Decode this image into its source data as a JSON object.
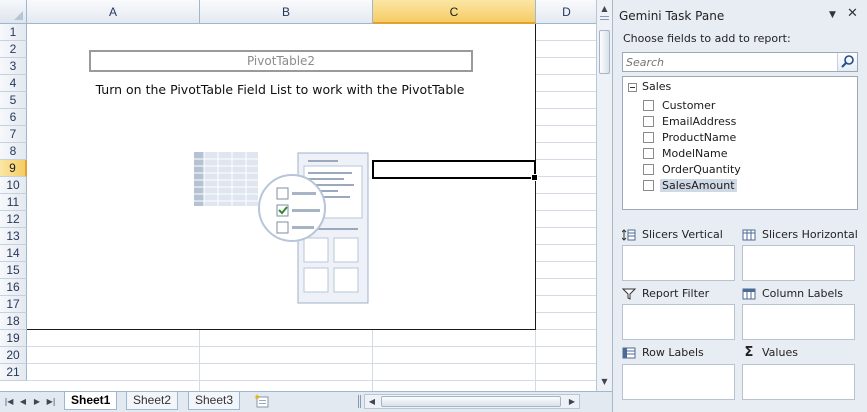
{
  "sheet": {
    "columns": [
      "A",
      "B",
      "C",
      "D"
    ],
    "selected_column": "C",
    "rows": [
      "1",
      "2",
      "3",
      "4",
      "5",
      "6",
      "7",
      "8",
      "9",
      "10",
      "11",
      "12",
      "13",
      "14",
      "15",
      "16",
      "17",
      "18",
      "19",
      "20",
      "21"
    ],
    "selected_row": "9",
    "pivot_name": "PivotTable2",
    "pivot_hint": "Turn on the PivotTable Field List to work with the PivotTable",
    "tabs": [
      "Sheet1",
      "Sheet2",
      "Sheet3"
    ],
    "active_tab": "Sheet1"
  },
  "task_pane": {
    "title": "Gemini Task Pane",
    "choose_label": "Choose fields to add to report:",
    "search_placeholder": "Search",
    "table_name": "Sales",
    "fields": [
      {
        "label": "Customer",
        "checked": false,
        "highlighted": false
      },
      {
        "label": "EmailAddress",
        "checked": false,
        "highlighted": false
      },
      {
        "label": "ProductName",
        "checked": false,
        "highlighted": false
      },
      {
        "label": "ModelName",
        "checked": false,
        "highlighted": false
      },
      {
        "label": "OrderQuantity",
        "checked": false,
        "highlighted": false
      },
      {
        "label": "SalesAmount",
        "checked": false,
        "highlighted": true
      }
    ],
    "areas": {
      "slicers_vertical": "Slicers Vertical",
      "slicers_horizontal": "Slicers Horizontal",
      "report_filter": "Report Filter",
      "column_labels": "Column Labels",
      "row_labels": "Row Labels",
      "values": "Values"
    }
  },
  "colors": {
    "header_selected": "#f6cc66",
    "grid_line": "#d4dbe4",
    "pane_bg": "#e8edf4",
    "highlight": "#cfd8e5"
  }
}
